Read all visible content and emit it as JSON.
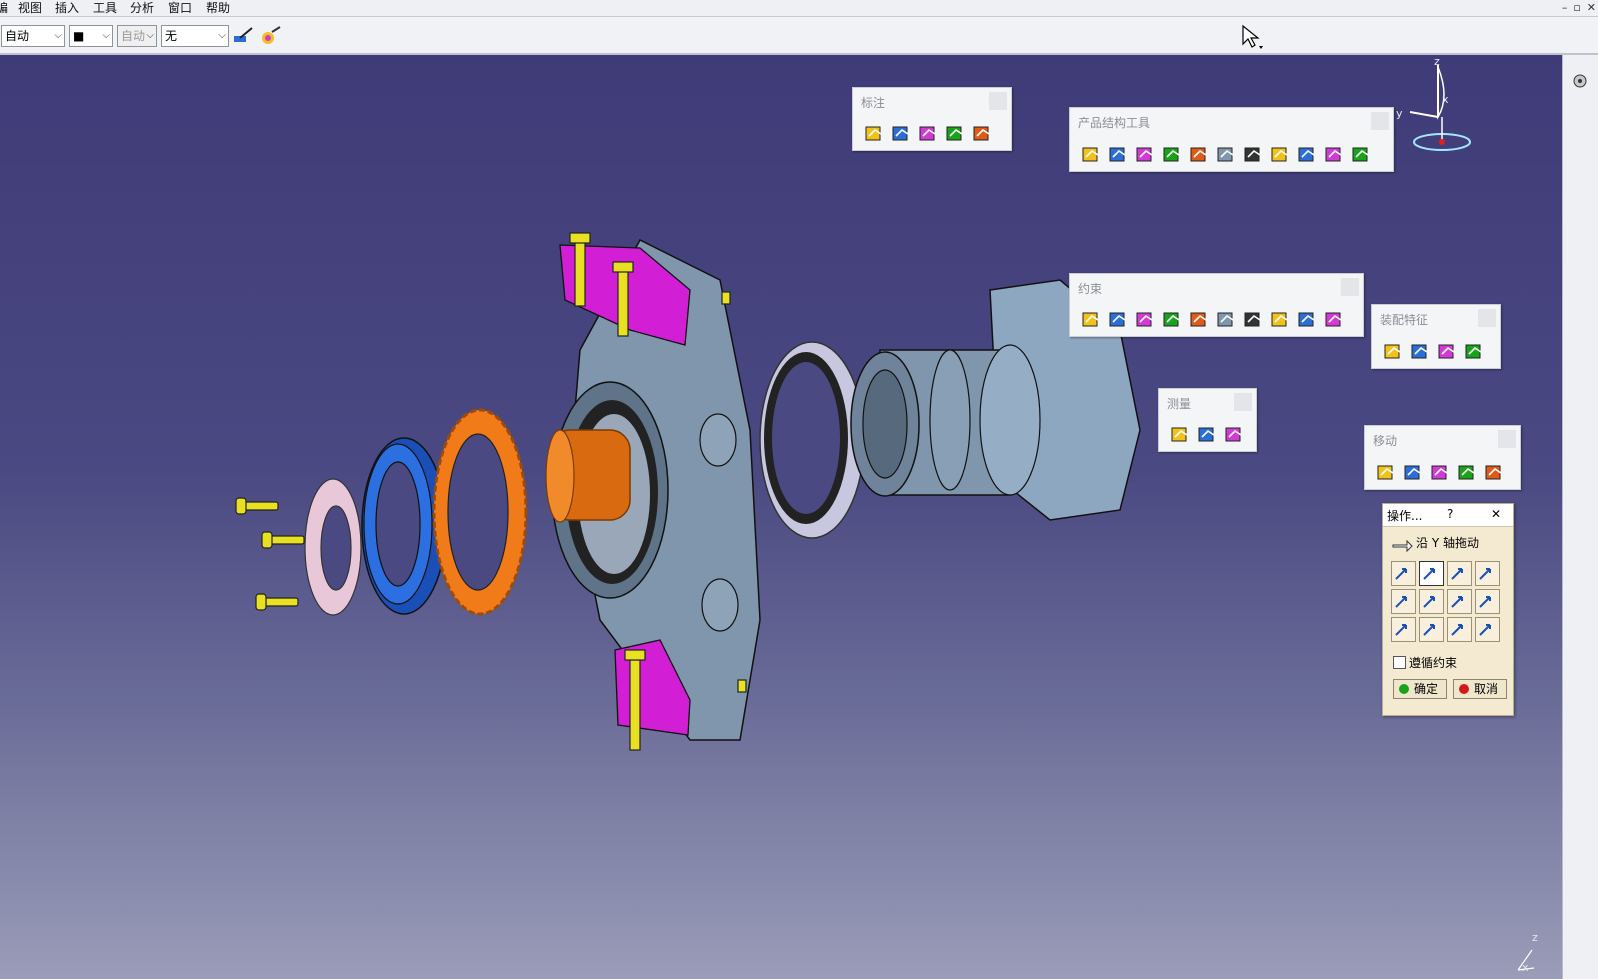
{
  "menu": {
    "partial_left": "编",
    "items": [
      "视图",
      "插入",
      "工具",
      "分析",
      "窗口",
      "帮助"
    ],
    "window_buttons": [
      "–",
      "▫",
      "✕"
    ]
  },
  "toolbar": {
    "combo_fill": "自动",
    "combo_color": "■",
    "combo_line": "自动",
    "combo_layer": "无"
  },
  "panels": {
    "annotation": {
      "title": "标注",
      "icons": [
        "weld-icon",
        "abc-text-icon",
        "flag-note-icon",
        "3d-annotation-icon",
        "annotation-plane-icon"
      ]
    },
    "product_structure": {
      "title": "产品结构工具",
      "icons": [
        "gear-new-component-icon",
        "gear-new-product-icon",
        "gear-new-part-icon",
        "existing-component-icon",
        "existing-positioning-icon",
        "replace-component-icon",
        "graph-tree-reorder-icon",
        "generate-numbering-icon",
        "selective-load-icon",
        "manage-representations-icon",
        "multi-instantiation-icon"
      ]
    },
    "constraints": {
      "title": "约束",
      "icons": [
        "coincidence-icon",
        "contact-icon",
        "offset-icon",
        "angle-icon",
        "fix-component-icon",
        "fix-together-icon",
        "quick-constraint-icon",
        "flexible-rigid-icon",
        "change-constraint-icon",
        "reuse-pattern-icon"
      ]
    },
    "assembly_features": {
      "title": "装配特征",
      "icons": [
        "split-icon",
        "hole-icon",
        "pocket-icon",
        "remove-icon"
      ]
    },
    "measure": {
      "title": "测量",
      "icons": [
        "measure-between-icon",
        "measure-item-icon",
        "measure-inertia-icon"
      ]
    },
    "move": {
      "title": "移动",
      "icons": [
        "manipulation-icon",
        "snap-icon",
        "smart-move-icon",
        "explode-icon",
        "clash-stop-icon"
      ]
    }
  },
  "dialog": {
    "title": "操作...",
    "help": "?",
    "close": "✕",
    "mode_label": "沿 Y 轴拖动",
    "option_label": "遵循约束",
    "option_checked": false,
    "ok_label": "确定",
    "cancel_label": "取消",
    "grid_icons": [
      "drag-x-icon",
      "drag-y-icon",
      "drag-z-icon",
      "drag-along-line-icon",
      "drag-xy-icon",
      "drag-yz-icon",
      "drag-xz-icon",
      "drag-plane-icon",
      "rotate-x-icon",
      "rotate-y-icon",
      "rotate-z-icon",
      "rotate-axis-icon"
    ],
    "selected_index": 1
  },
  "compass": {
    "x": "x",
    "y": "y",
    "z": "z"
  },
  "corner_axis": {
    "x": "x",
    "z": "z"
  },
  "colors": {
    "viewport_top": "#3f3b78",
    "part_gray": "#7f96ad",
    "bracket_magenta": "#d21fd6",
    "ring_blue": "#1f5fd0",
    "ring_orange": "#f07b18",
    "bolt_yellow": "#e8e020",
    "dialog_bg": "#f4ead2"
  }
}
